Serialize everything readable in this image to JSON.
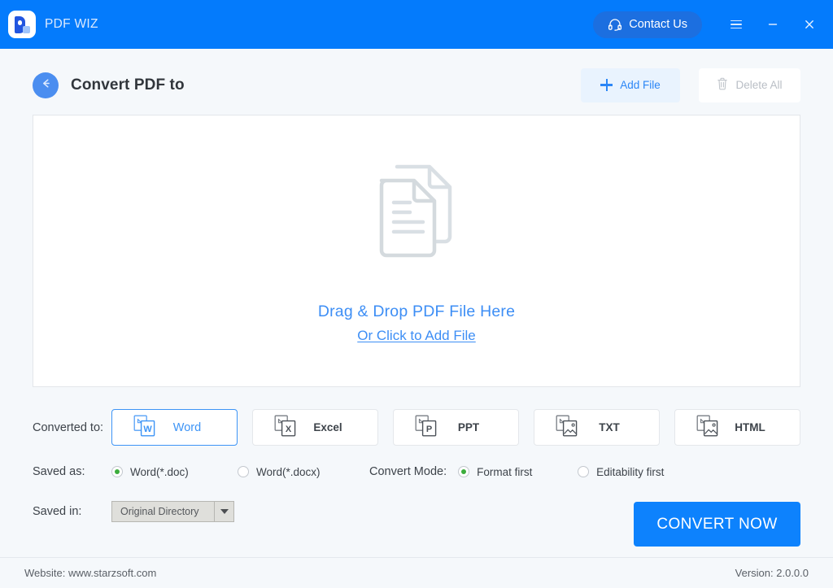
{
  "titlebar": {
    "app_name": "PDF WIZ",
    "logo_icon": "pdfwiz-logo-icon",
    "contact_label": "Contact Us",
    "contact_icon": "headset-icon",
    "menu_icon": "hamburger-menu-icon",
    "minimize_icon": "minimize-icon",
    "close_icon": "close-icon",
    "bg_color": "#047bfc"
  },
  "header": {
    "back_icon": "arrow-left-icon",
    "title": "Convert PDF to",
    "add_file_label": "Add File",
    "add_file_icon": "plus-icon",
    "delete_all_label": "Delete All",
    "delete_all_icon": "trash-icon",
    "delete_all_disabled": true
  },
  "dropzone": {
    "icon": "documents-stack-icon",
    "primary_text": "Drag & Drop PDF File Here",
    "secondary_text": "Or Click to Add File",
    "accent_color": "#3d8ef5"
  },
  "converted_to": {
    "label": "Converted to:",
    "selected": "Word",
    "options": [
      {
        "name": "Word",
        "icon": "pdf-to-word-icon",
        "badge": "W",
        "selected": true
      },
      {
        "name": "Excel",
        "icon": "pdf-to-excel-icon",
        "badge": "X",
        "selected": false
      },
      {
        "name": "PPT",
        "icon": "pdf-to-ppt-icon",
        "badge": "P",
        "selected": false
      },
      {
        "name": "TXT",
        "icon": "pdf-to-txt-icon",
        "badge": "img",
        "selected": false
      },
      {
        "name": "HTML",
        "icon": "pdf-to-html-icon",
        "badge": "img",
        "selected": false
      }
    ]
  },
  "saved_as": {
    "label": "Saved as:",
    "options": [
      {
        "label": "Word(*.doc)",
        "selected": true
      },
      {
        "label": "Word(*.docx)",
        "selected": false
      }
    ]
  },
  "convert_mode": {
    "label": "Convert Mode:",
    "options": [
      {
        "label": "Format first",
        "selected": true
      },
      {
        "label": "Editability first",
        "selected": false
      }
    ]
  },
  "saved_in": {
    "label": "Saved in:",
    "value": "Original Directory",
    "arrow_icon": "chevron-down-icon"
  },
  "convert_now": {
    "label": "CONVERT NOW",
    "color": "#0d82fd"
  },
  "footer": {
    "website": "Website: www.starzsoft.com",
    "version": "Version: 2.0.0.0"
  }
}
